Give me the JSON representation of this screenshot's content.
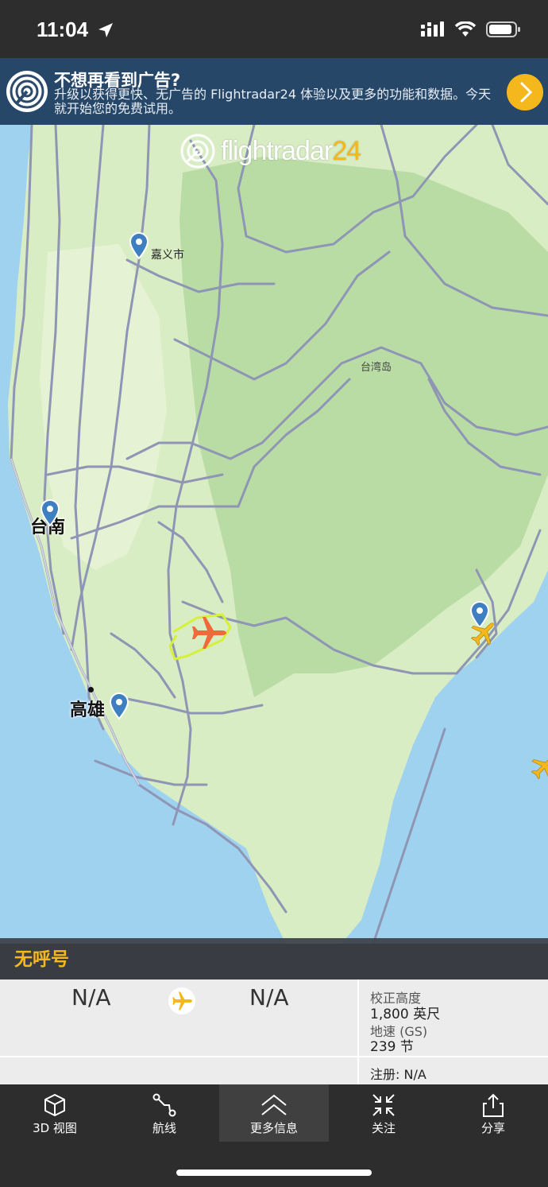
{
  "status_bar": {
    "time": "11:04",
    "icons": [
      "location-arrow-icon",
      "cellular-signal-icon",
      "wifi-icon",
      "battery-icon"
    ]
  },
  "ad_banner": {
    "title": "不想再看到广告?",
    "text": "升级以获得更快、无广告的 Flightradar24 体验以及更多的功能和数据。今天就开始您的免费试用。",
    "icon": "radar-logo-icon",
    "action_icon": "chevron-right-icon"
  },
  "map": {
    "watermark_main": "flightradar",
    "watermark_num": "24",
    "labels": {
      "chiayi": "嘉义市",
      "taiwan_island": "台湾岛",
      "tainan": "台南",
      "kaohsiung": "高雄"
    },
    "colors": {
      "sea": "#9fd2ef",
      "land": "#d9edc4",
      "road": "#8f95b4",
      "selected_aircraft": "#ef6a3b",
      "aircraft": "#f4b81c",
      "track": "#d6f03a"
    }
  },
  "flight": {
    "callsign": "无呼号",
    "origin": "N/A",
    "destination": "N/A",
    "calibrated_altitude_label": "校正高度",
    "calibrated_altitude_value": "1,800 英尺",
    "ground_speed_label": "地速 (GS)",
    "ground_speed_value": "239 节",
    "registration": "注册: N/A"
  },
  "toolbar": {
    "items": [
      {
        "label": "3D 视图",
        "icon": "cube-icon"
      },
      {
        "label": "航线",
        "icon": "route-icon"
      },
      {
        "label": "更多信息",
        "icon": "double-chevron-up-icon"
      },
      {
        "label": "关注",
        "icon": "focus-arrows-icon"
      },
      {
        "label": "分享",
        "icon": "share-icon"
      }
    ],
    "active_index": 2
  }
}
